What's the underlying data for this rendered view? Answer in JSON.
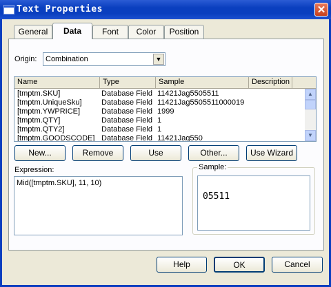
{
  "window": {
    "title": "Text Properties",
    "close_glyph": "✕"
  },
  "tabs": [
    {
      "label": "General"
    },
    {
      "label": "Data"
    },
    {
      "label": "Font"
    },
    {
      "label": "Color"
    },
    {
      "label": "Position"
    }
  ],
  "origin": {
    "label": "Origin:",
    "value": "Combination",
    "arrow_glyph": "▼"
  },
  "fields": {
    "columns": [
      "Name",
      "Type",
      "Sample",
      "Description"
    ],
    "rows": [
      [
        "[tmptm.SKU]",
        "Database Field",
        "11421Jag5505511",
        ""
      ],
      [
        "[tmptm.UniqueSku]",
        "Database Field",
        "11421Jag5505511000019",
        ""
      ],
      [
        "[tmptm.YWPRICE]",
        "Database Field",
        "1999",
        ""
      ],
      [
        "[tmptm.QTY]",
        "Database Field",
        "1",
        ""
      ],
      [
        "[tmptm.QTY2]",
        "Database Field",
        "1",
        ""
      ],
      [
        "[tmptm.GOODSCODE]",
        "Database Field",
        "11421Jag550",
        ""
      ]
    ],
    "scroll_up": "▲",
    "scroll_down": "▼"
  },
  "buttons": {
    "new": "New...",
    "remove": "Remove",
    "use": "Use",
    "other": "Other...",
    "use_wizard": "Use Wizard"
  },
  "expression": {
    "label": "Expression:",
    "value": "Mid([tmptm.SKU], 11, 10)"
  },
  "sample": {
    "label": "Sample:",
    "value": "05511"
  },
  "dialog_buttons": {
    "help": "Help",
    "ok": "OK",
    "cancel": "Cancel"
  }
}
